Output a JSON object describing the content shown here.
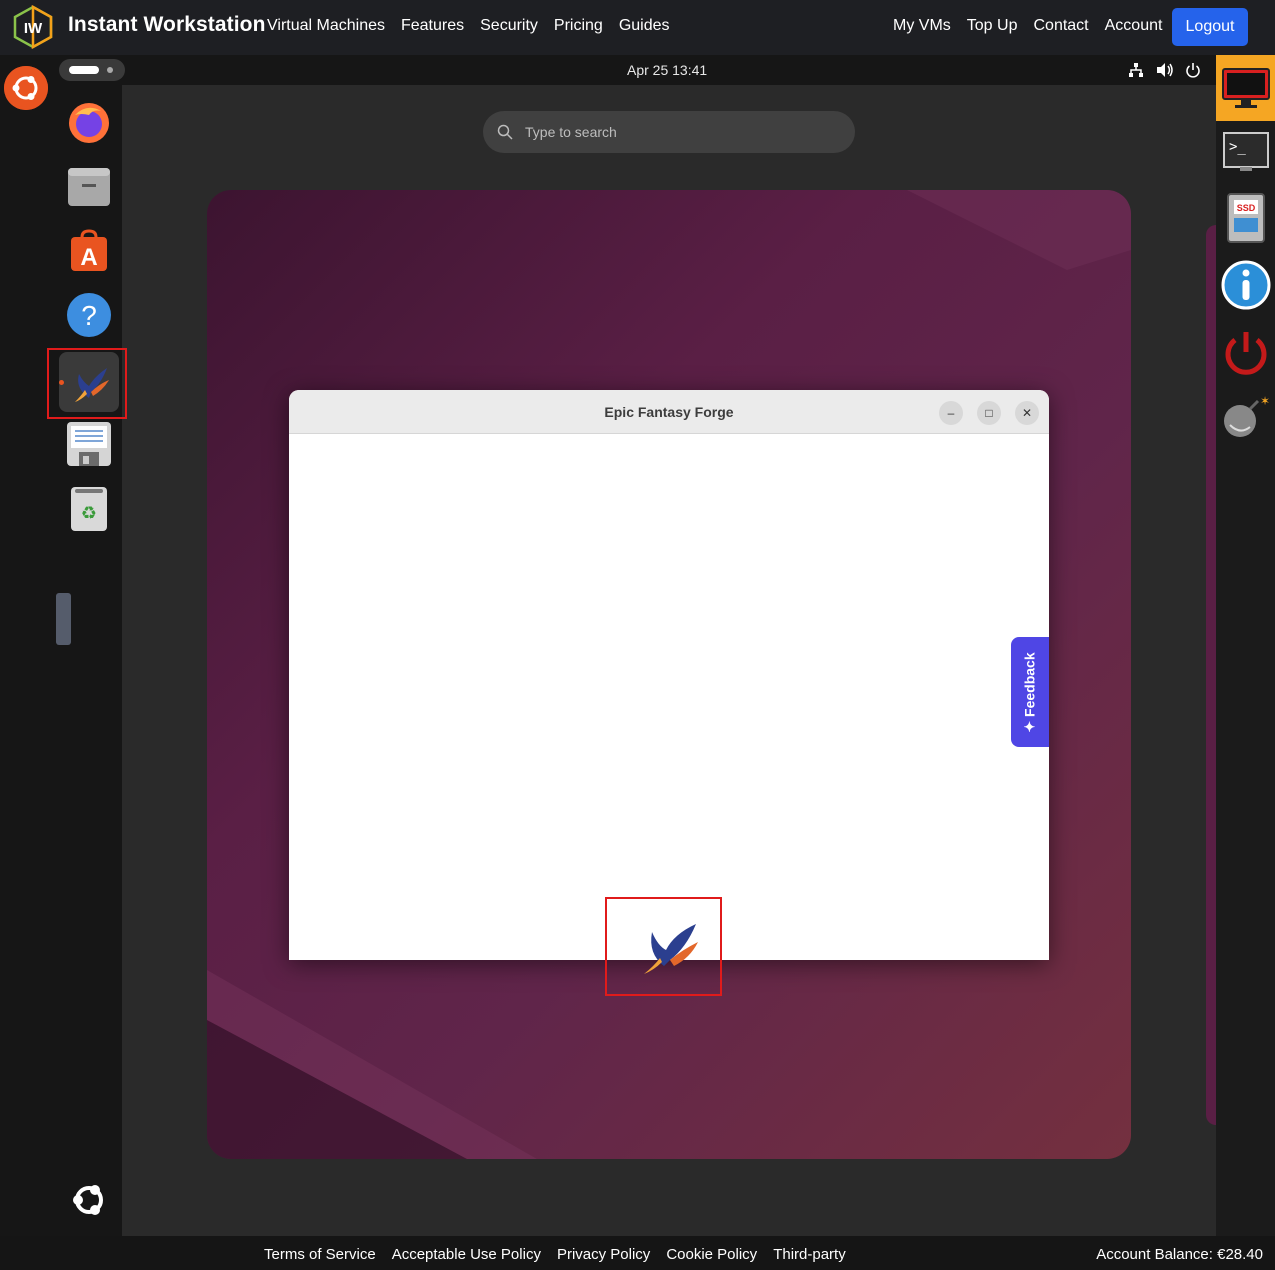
{
  "nav": {
    "brand": "Instant Workstation",
    "logo_text": "IW",
    "left_links": [
      "Virtual Machines",
      "Features",
      "Security",
      "Pricing",
      "Guides"
    ],
    "right_links": [
      "My VMs",
      "Top Up",
      "Contact",
      "Account"
    ],
    "logout": "Logout"
  },
  "gnome": {
    "clock": "Apr 25  13:41",
    "search_placeholder": "Type to search"
  },
  "dock": {
    "apps": [
      "firefox-icon",
      "files-icon",
      "app-center-icon",
      "help-icon",
      "epic-fantasy-forge-icon",
      "text-editor-icon",
      "trash-icon"
    ]
  },
  "window": {
    "title": "Epic Fantasy Forge",
    "minimize": "–",
    "maximize": "□",
    "close": "✕"
  },
  "feedback": "Feedback",
  "footer": {
    "links": [
      "Terms of Service",
      "Acceptable Use Policy",
      "Privacy Policy",
      "Cookie Policy",
      "Third-party"
    ],
    "balance": "Account Balance: €28.40"
  },
  "right_panel": {
    "ssd_label": "SSD"
  },
  "colors": {
    "accent": "#2563eb",
    "ubuntu": "#e95420",
    "highlight": "#e01b1b",
    "feedback": "#4f46e5"
  }
}
